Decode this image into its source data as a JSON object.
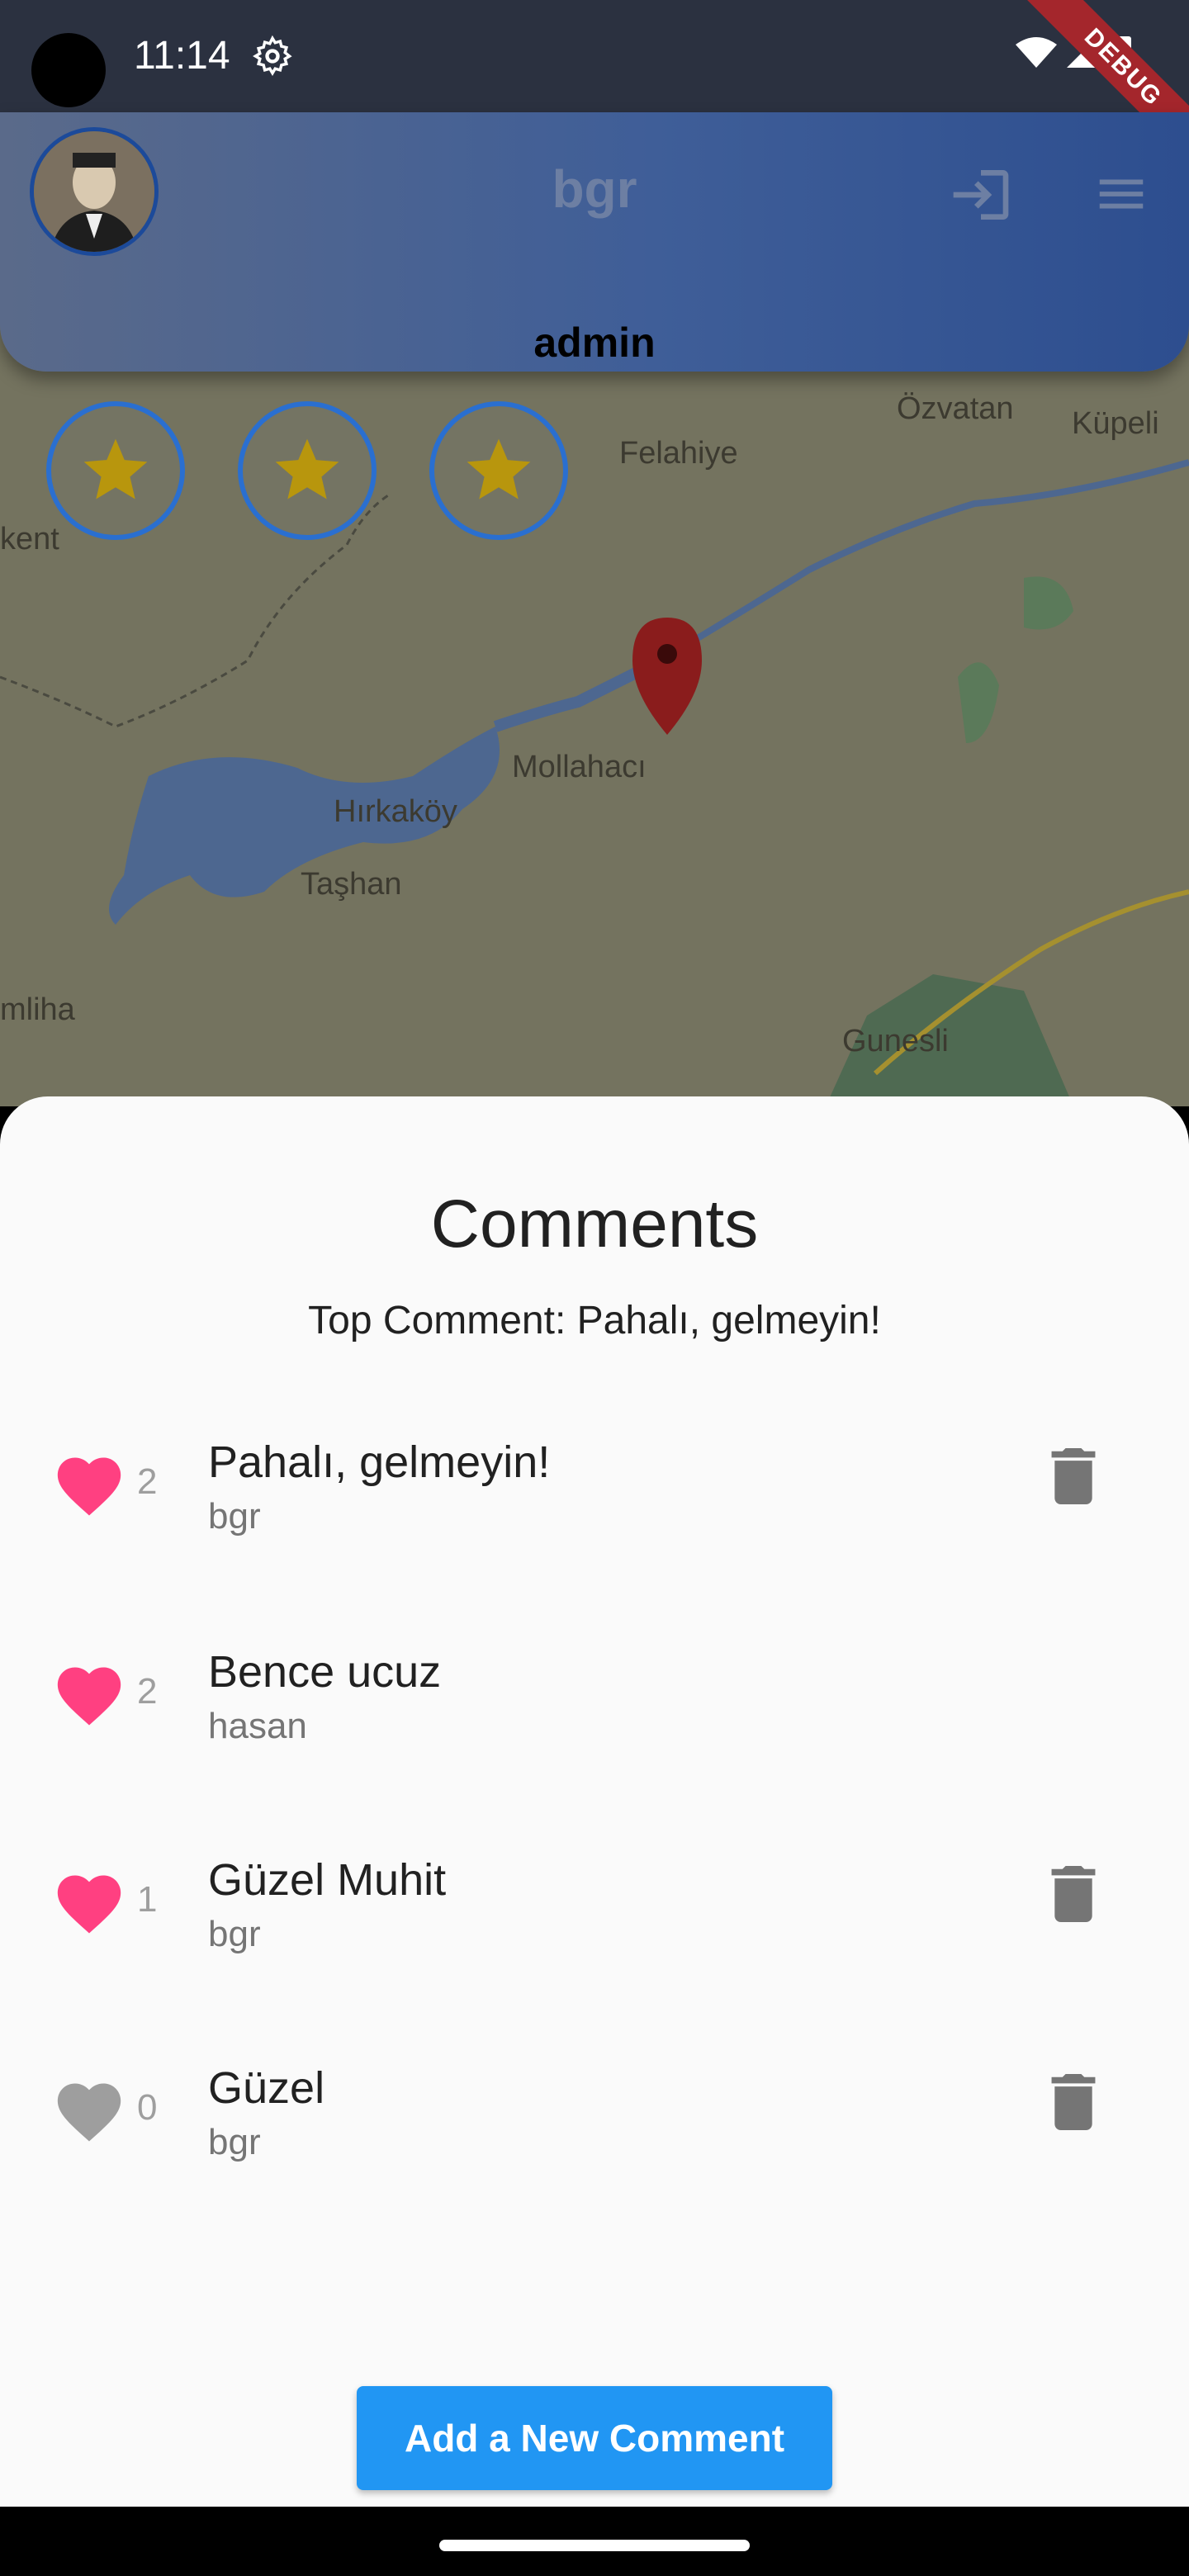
{
  "status_bar": {
    "time": "11:14",
    "debug_banner": "DEBUG"
  },
  "app_bar": {
    "title": "bgr",
    "username": "admin"
  },
  "map": {
    "places": [
      "Özvatan",
      "Küpeli",
      "Felahiye",
      "kent",
      "Mollahacı",
      "Hırkaköy",
      "Taşhan",
      "mliha",
      "Gunesli"
    ]
  },
  "rating_buttons": [
    "star-icon",
    "star-icon",
    "star-icon"
  ],
  "sheet": {
    "title": "Comments",
    "top_comment": "Top Comment: Pahalı, gelmeyin!",
    "comments": [
      {
        "text": "Pahalı, gelmeyin!",
        "user": "bgr",
        "likes": "2",
        "liked": true,
        "deletable": true
      },
      {
        "text": "Bence ucuz",
        "user": "hasan",
        "likes": "2",
        "liked": true,
        "deletable": false
      },
      {
        "text": "Güzel Muhit",
        "user": "bgr",
        "likes": "1",
        "liked": true,
        "deletable": true
      },
      {
        "text": "Güzel",
        "user": "bgr",
        "likes": "0",
        "liked": false,
        "deletable": true
      }
    ],
    "add_button": "Add a New Comment"
  },
  "colors": {
    "liked": "#ff4081",
    "unliked": "#9e9e9e",
    "accent": "#2196f3"
  }
}
